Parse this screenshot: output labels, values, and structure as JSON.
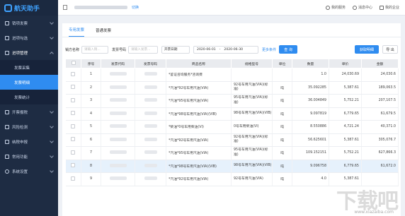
{
  "app": {
    "logo_text": "航天助手"
  },
  "sidebar": {
    "items": [
      {
        "label": "销项发票"
      },
      {
        "label": "进项勾选"
      },
      {
        "label": "进项管理",
        "expanded": true
      }
    ],
    "subitems": [
      {
        "label": "发票采集"
      },
      {
        "label": "发票明细",
        "active": true
      },
      {
        "label": "发票统计"
      }
    ],
    "items_after": [
      {
        "label": "开票报税"
      },
      {
        "label": "风险检测"
      },
      {
        "label": "纳税申报"
      },
      {
        "label": "常用功能"
      },
      {
        "label": "系统设置"
      }
    ]
  },
  "topbar": {
    "switch_label": "切换",
    "actions": [
      "我的服务",
      "消息中心",
      "我的企业"
    ]
  },
  "tabs": [
    {
      "label": "专用发票",
      "active": true
    },
    {
      "label": "普通发票"
    }
  ],
  "filter": {
    "seller_label": "销方名称",
    "seller_placeholder": "请输入销...",
    "invoice_no_label": "发票号码",
    "invoice_no_placeholder": "请输入发票...",
    "date_type": "开票日期",
    "date_from": "2020-06-01",
    "date_to": "2020-06-30",
    "more_label": "更多条件",
    "search_button": "查 询",
    "fetch_button": "获取明细",
    "export_button": "导 出"
  },
  "table": {
    "headers": [
      "序号",
      "发票代码",
      "发票号码",
      "商品名称",
      "规格型号",
      "单位",
      "数量",
      "单价",
      "金额"
    ],
    "rows": [
      {
        "no": "1",
        "name": "*鉴证咨询服务*咨询费",
        "spec": "",
        "unit": "",
        "qty": "1.0",
        "price": "24,030.69",
        "amount": "24,030.6"
      },
      {
        "no": "2",
        "name": "*汽油*92号车用汽油(VIA)",
        "spec": "92号车用汽油(VIA)(标准)",
        "unit": "吨",
        "qty": "35.092285",
        "price": "5,387.61",
        "amount": "189,063.5"
      },
      {
        "no": "3",
        "name": "*汽油*95号车用汽油(VIA)",
        "spec": "95号车用汽油(VIA)(标准)",
        "unit": "吨",
        "qty": "36.004849",
        "price": "5,752.21",
        "amount": "207,107.5"
      },
      {
        "no": "4",
        "name": "*汽油*98号车用汽油(VIA)(VIB)",
        "spec": "98号车用汽油(VIA)(VIB)",
        "unit": "吨",
        "qty": "9.097819",
        "price": "6,779.65",
        "amount": "61,679.5"
      },
      {
        "no": "5",
        "name": "*柴油*0号车用柴油(VI)",
        "spec": "0号车用柴油(VI)",
        "unit": "吨",
        "qty": "8.550886",
        "price": "4,721.24",
        "amount": "40,371.0"
      },
      {
        "no": "6",
        "name": "*汽油*92号车用汽油(VIA)",
        "spec": "92号车用汽油(VIA)(标准)",
        "unit": "吨",
        "qty": "56.625601",
        "price": "5,387.61",
        "amount": "305,076.7"
      },
      {
        "no": "7",
        "name": "*汽油*95号车用汽油(VIA)",
        "spec": "95号车用汽油(VIA)(标准)",
        "unit": "吨",
        "qty": "109.152151",
        "price": "5,752.21",
        "amount": "627,866.3"
      },
      {
        "no": "8",
        "name": "*汽油*98号车用汽油(VIA)(VIB)",
        "spec": "98号车用汽油(VIA)(VIB)",
        "unit": "吨",
        "qty": "9.096758",
        "price": "6,779.65",
        "amount": "61,672.0",
        "selected": true
      },
      {
        "no": "9",
        "name": "*汽油*92号车用汽油(VIA)",
        "spec": "92号车用汽油(VIA)",
        "unit": "吨",
        "qty": "4.0",
        "price": "5,387.61",
        "amount": "",
        "partial": true
      }
    ]
  },
  "watermark": {
    "text": "下载吧",
    "url": "www.xiazaiba.com"
  },
  "colors": {
    "sidebar_bg": "#1e2c43",
    "accent": "#2f8cf0",
    "selected_row": "#e6f1fc"
  }
}
